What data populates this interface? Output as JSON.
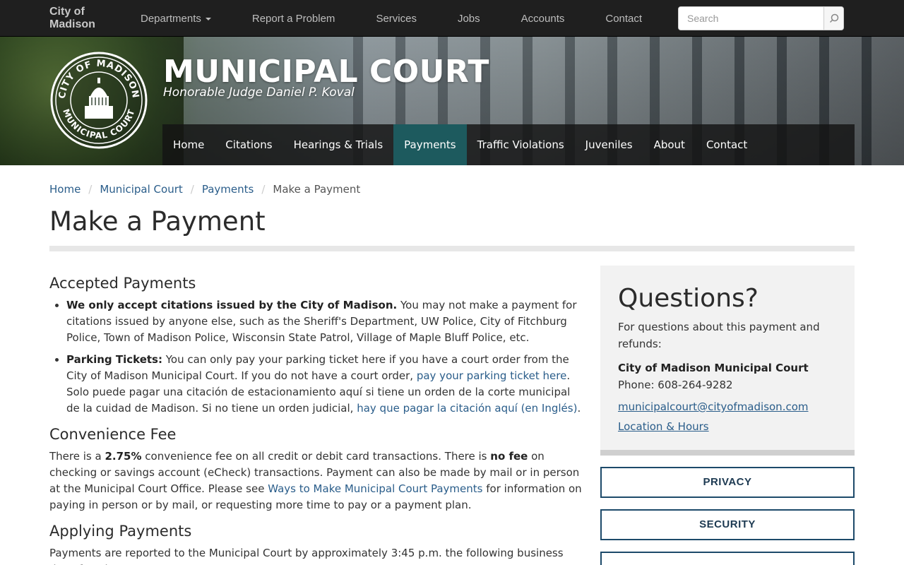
{
  "topbar": {
    "brand_line1": "City of",
    "brand_line2": "Madison",
    "nav": [
      {
        "label": "Departments",
        "dropdown": true
      },
      {
        "label": "Report a Problem"
      },
      {
        "label": "Services"
      },
      {
        "label": "Jobs"
      },
      {
        "label": "Accounts"
      },
      {
        "label": "Contact"
      }
    ],
    "search_placeholder": "Search"
  },
  "hero": {
    "seal_text_top": "CITY OF MADISON",
    "seal_text_bottom": "MUNICIPAL COURT",
    "title": "MUNICIPAL COURT",
    "subtitle": "Honorable Judge Daniel P. Koval",
    "nav": [
      {
        "label": "Home"
      },
      {
        "label": "Citations"
      },
      {
        "label": "Hearings & Trials"
      },
      {
        "label": "Payments",
        "active": true
      },
      {
        "label": "Traffic Violations"
      },
      {
        "label": "Juveniles"
      },
      {
        "label": "About"
      },
      {
        "label": "Contact"
      }
    ]
  },
  "breadcrumb": {
    "items": [
      "Home",
      "Municipal Court",
      "Payments"
    ],
    "current": "Make a Payment"
  },
  "page": {
    "title": "Make a Payment"
  },
  "content": {
    "accepted": {
      "heading": "Accepted Payments",
      "item1_bold": "We only accept citations issued by the City of Madison.",
      "item1_text": " You may not make a payment for citations issued by anyone else, such as the Sheriff's Department, UW Police, City of Fitchburg Police, Town of Madison Police, Wisconsin State Patrol, Village of Maple Bluff Police, etc.",
      "item2_bold": "Parking Tickets:",
      "item2_text": " You can only pay your parking ticket here if you have a court order from the City of Madison Municipal Court. If you do not have a court order, ",
      "item2_link": "pay your parking ticket here",
      "item2_end": ".",
      "item2_es_text": "Solo puede pagar una citación de estacionamiento aquí si tiene un orden de la corte municipal de la cuidad de Madison. Si no tiene un orden judicial, ",
      "item2_es_link": "hay que pagar la citación aquí (en Inglés)",
      "item2_es_end": "."
    },
    "fee": {
      "heading": "Convenience Fee",
      "t1": "There is a ",
      "b1": "2.75%",
      "t2": " convenience fee on all credit or debit card transactions. There is ",
      "b2": "no fee",
      "t3": " on checking or savings account (eCheck) transactions. Payment can also be made by mail or in person at the Municipal Court Office. Please see ",
      "link": "Ways to Make Municipal Court Payments",
      "t4": " for information on paying in person or by mail, or requesting more time to pay or a payment plan."
    },
    "applying": {
      "heading": "Applying Payments",
      "text": "Payments are reported to the Municipal Court by approximately 3:45 p.m. the following business day after the"
    }
  },
  "sidebar": {
    "questions_heading": "Questions?",
    "questions_text": "For questions about this payment and refunds:",
    "org": "City of Madison Municipal Court",
    "phone": "Phone: 608-264-9282",
    "email": "municipalcourt@cityofmadison.com",
    "location_link": "Location & Hours",
    "buttons": [
      "PRIVACY",
      "SECURITY"
    ]
  }
}
